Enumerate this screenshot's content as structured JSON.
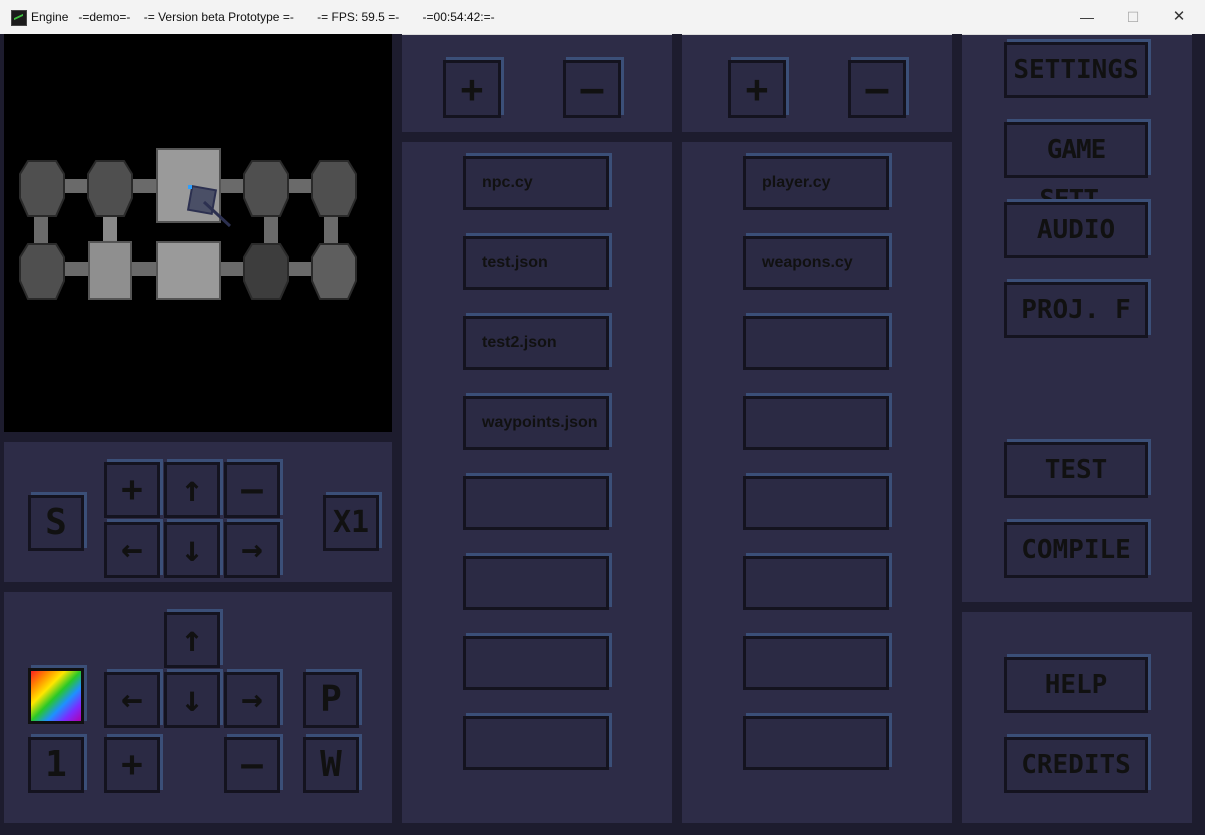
{
  "titlebar": {
    "app": "Engine",
    "text": "Engine   -=demo=-    -= Version beta Prototype =-       -= FPS: 59.5 =-       -=00:54:42:=-",
    "minimize": "—",
    "maximize": "☐",
    "close": "✕"
  },
  "colors": {
    "panel": "#2d2c47",
    "button_shadow": "#3b4f78",
    "viewport": "#000000"
  },
  "top_controls": {
    "left_add": "+",
    "left_remove": "—",
    "right_add": "+",
    "right_remove": "—"
  },
  "files_left": [
    "npc.cy",
    "test.json",
    "test2.json",
    "waypoints.json",
    "",
    "",
    "",
    ""
  ],
  "files_right": [
    "player.cy",
    "weapons.cy",
    "",
    "",
    "",
    "",
    "",
    ""
  ],
  "menu": {
    "settings": "SETTINGS",
    "game_settings": "GAME SETT.",
    "audio": "AUDIO",
    "proj_f": "PROJ. F",
    "test": "TEST",
    "compile": "COMPILE",
    "help": "HELP",
    "credits": "CREDITS"
  },
  "camera_controls": {
    "speed": "S",
    "zoom_in": "+",
    "up": "↑",
    "zoom_out": "—",
    "left": "←",
    "down": "↓",
    "right": "→",
    "scale": "X1"
  },
  "tile_controls": {
    "up": "↑",
    "left": "←",
    "down": "↓",
    "right": "→",
    "paint": "P",
    "layer": "1",
    "add": "+",
    "remove": "—",
    "wall": "W",
    "palette_icon": "rainbow-palette-icon"
  }
}
